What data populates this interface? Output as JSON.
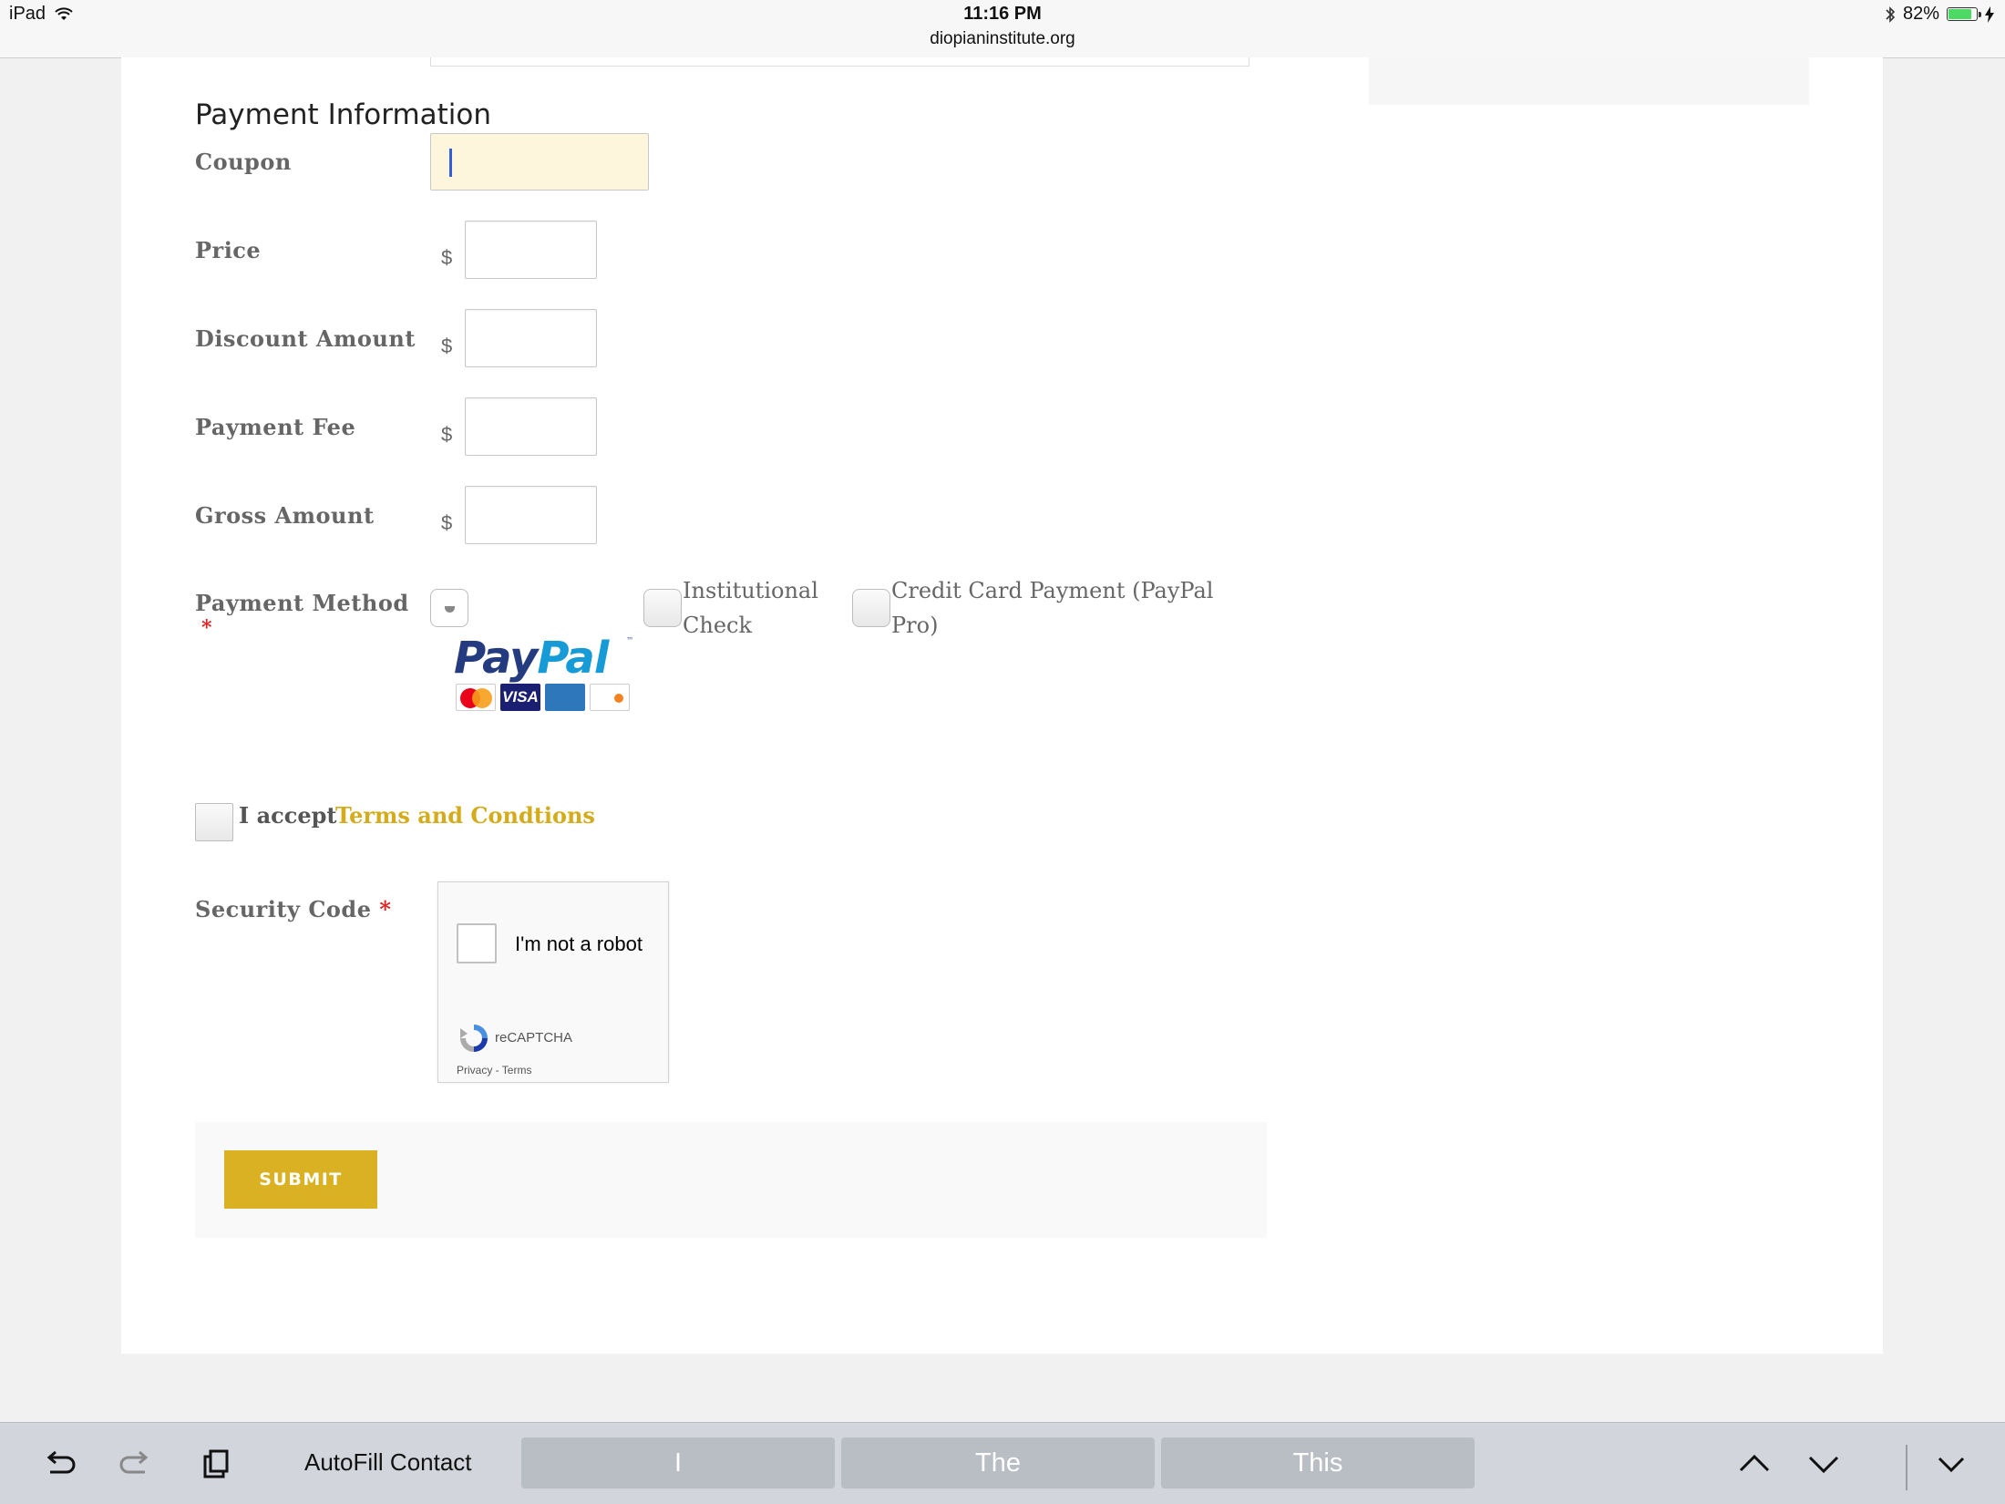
{
  "status_bar": {
    "device": "iPad",
    "time": "11:16 PM",
    "url": "diopianinstitute.org",
    "battery": "82%",
    "battery_level": 0.82
  },
  "form": {
    "section_title": "Payment Information",
    "coupon": {
      "label": "Coupon",
      "value": ""
    },
    "price": {
      "label": "Price",
      "currency": "$",
      "value": ""
    },
    "discount": {
      "label": "Discount Amount",
      "currency": "$",
      "value": ""
    },
    "fee": {
      "label": "Payment Fee",
      "currency": "$",
      "value": ""
    },
    "gross": {
      "label": "Gross Amount",
      "currency": "$",
      "value": ""
    },
    "payment_method": {
      "label": "Payment Method",
      "required_mark": "*",
      "options": [
        {
          "label": "PayPal",
          "selected": true
        },
        {
          "label": "Institutional Check",
          "line1": "Institutional",
          "line2": "Check",
          "selected": false
        },
        {
          "label": "Credit Card Payment (PayPal Pro)",
          "line1": "Credit Card Payment (PayPal",
          "line2": "Pro)",
          "selected": false
        }
      ],
      "paypal_logo": {
        "pay": "Pay",
        "pal": "Pal",
        "tm": "™",
        "cards": [
          "MasterCard",
          "VISA",
          "AMEX",
          "DISCOVER"
        ],
        "visa_text": "VISA"
      }
    },
    "terms": {
      "prefix": "I accept",
      "link": "Terms and Condtions",
      "checked": false
    },
    "security": {
      "label": "Security Code",
      "required_mark": "*",
      "captcha_text": "I'm not a robot",
      "captcha_brand": "reCAPTCHA",
      "captcha_links": "Privacy - Terms"
    },
    "submit_label": "SUBMIT"
  },
  "keyboard_bar": {
    "autofill": "AutoFill Contact",
    "suggestions": [
      "I",
      "The",
      "This"
    ]
  },
  "colors": {
    "accent": "#d9b123",
    "link": "#d3ab1b",
    "required": "#e02020",
    "coupon_bg": "#fdf5dc"
  }
}
